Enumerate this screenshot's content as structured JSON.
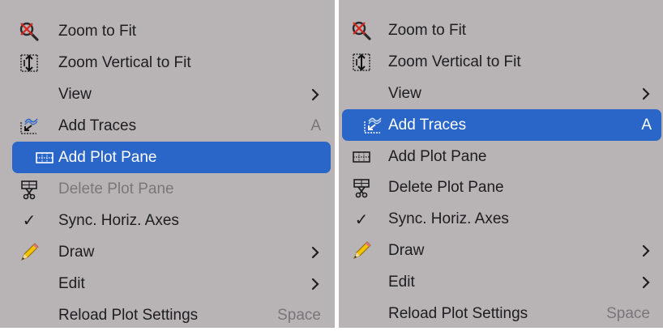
{
  "left_menu": {
    "items": [
      {
        "label": "Zoom to Fit",
        "icon": "zoom-to-fit-icon"
      },
      {
        "label": "Zoom Vertical to Fit",
        "icon": "zoom-vertical-icon"
      },
      {
        "label": "View",
        "submenu": true
      },
      {
        "label": "Add Traces",
        "icon": "add-traces-icon",
        "shortcut": "A"
      },
      {
        "label": "Add Plot Pane",
        "icon": "plot-pane-icon",
        "highlighted": true
      },
      {
        "label": "Delete Plot Pane",
        "icon": "delete-pane-icon",
        "disabled": true
      },
      {
        "label": "Sync. Horiz. Axes",
        "icon": "check-icon",
        "checked": true
      },
      {
        "label": "Draw",
        "icon": "pencil-icon",
        "submenu": true
      },
      {
        "label": "Edit",
        "submenu": true
      },
      {
        "label": "Reload Plot Settings",
        "shortcut": "Space"
      }
    ]
  },
  "right_menu": {
    "items": [
      {
        "label": "Zoom to Fit",
        "icon": "zoom-to-fit-icon"
      },
      {
        "label": "Zoom Vertical to Fit",
        "icon": "zoom-vertical-icon"
      },
      {
        "label": "View",
        "submenu": true
      },
      {
        "label": "Add Traces",
        "icon": "add-traces-icon",
        "shortcut": "A",
        "highlighted": true
      },
      {
        "label": "Add Plot Pane",
        "icon": "plot-pane-icon"
      },
      {
        "label": "Delete Plot Pane",
        "icon": "delete-pane-icon"
      },
      {
        "label": "Sync. Horiz. Axes",
        "icon": "check-icon",
        "checked": true
      },
      {
        "label": "Draw",
        "icon": "pencil-icon",
        "submenu": true
      },
      {
        "label": "Edit",
        "submenu": true
      },
      {
        "label": "Reload Plot Settings",
        "shortcut": "Space"
      }
    ]
  },
  "colors": {
    "menu_bg": "#b8b4b6",
    "highlight": "#2a66c8",
    "text": "#1d1d1f",
    "disabled_text": "#7a7779"
  }
}
